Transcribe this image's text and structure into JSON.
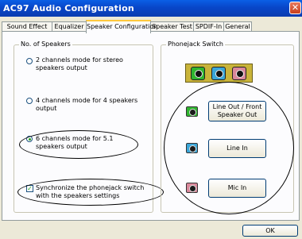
{
  "window": {
    "title": "AC97 Audio Configuration",
    "close_glyph": "✕"
  },
  "tabs": [
    {
      "label": "Sound Effect"
    },
    {
      "label": "Equalizer"
    },
    {
      "label": "Speaker Configuration"
    },
    {
      "label": "Speaker Test"
    },
    {
      "label": "SPDIF-In"
    },
    {
      "label": "General"
    }
  ],
  "speakers_group": {
    "label": "No. of Speakers",
    "options": [
      {
        "label": "2 channels mode for stereo speakers output",
        "selected": false
      },
      {
        "label": "4 channels mode for 4 speakers output",
        "selected": false
      },
      {
        "label": "6 channels mode for 5.1 speakers output",
        "selected": true
      }
    ],
    "sync_checkbox": {
      "label": "Synchronize the phonejack switch with the speakers settings",
      "checked": true
    }
  },
  "phonejack_group": {
    "label": "Phonejack Switch",
    "jacks": [
      {
        "label": "Line Out / Front Speaker Out",
        "color": "#2fb52f"
      },
      {
        "label": "Line In",
        "color": "#3aa6d8"
      },
      {
        "label": "Mic In",
        "color": "#d9879a"
      }
    ]
  },
  "ok_button": "OK"
}
